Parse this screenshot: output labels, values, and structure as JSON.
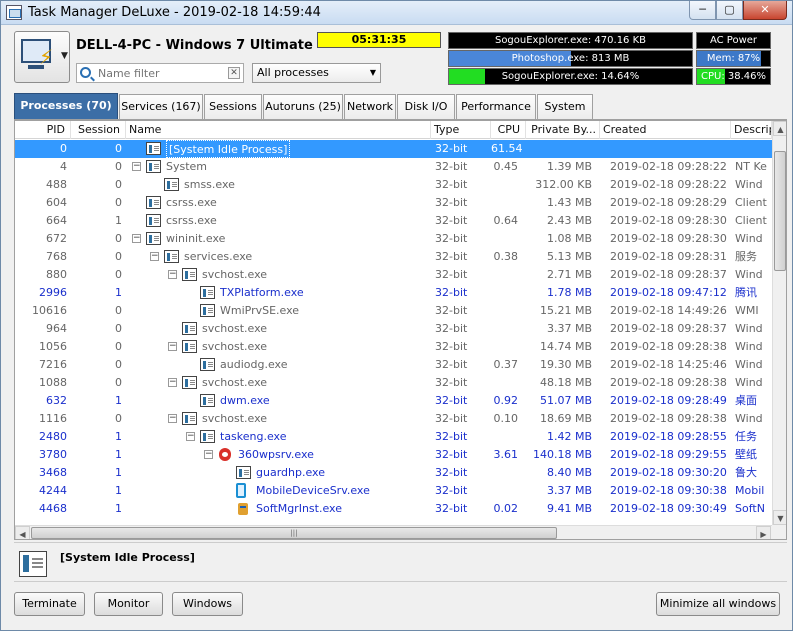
{
  "window": {
    "title": "Task Manager DeLuxe - 2019-02-18 14:59:44"
  },
  "window_controls": {
    "minimize": "─",
    "maximize": "▢",
    "close": "✕"
  },
  "header": {
    "computer": "DELL-4-PC - Windows 7 Ultimate",
    "uptime": "05:31:35",
    "filter_placeholder": "Name filter",
    "process_scope": "All processes"
  },
  "meters": [
    {
      "label": "SogouExplorer.exe: 470.16 KB",
      "fill": 0.0,
      "color": "#3c78c8"
    },
    {
      "label": "Photoshop.exe: 813 MB",
      "fill": 0.5,
      "color": "#4a86d8"
    },
    {
      "label": "SogouExplorer.exe: 14.64%",
      "fill": 0.15,
      "color": "#22dd22"
    },
    {
      "label": "AC Power",
      "fill": 0.0,
      "color": "#000000"
    },
    {
      "label": "Mem: 87%",
      "fill": 0.87,
      "color": "#3c78c8"
    },
    {
      "label": "CPU: 38.46%",
      "fill": 0.3846,
      "color": "#22dd22"
    }
  ],
  "tabs": [
    {
      "label": "Processes (70)",
      "active": true
    },
    {
      "label": "Services (167)"
    },
    {
      "label": "Sessions"
    },
    {
      "label": "Autoruns (25)"
    },
    {
      "label": "Network"
    },
    {
      "label": "Disk I/O"
    },
    {
      "label": "Performance"
    },
    {
      "label": "System"
    }
  ],
  "columns": [
    "PID",
    "Session",
    "Name",
    "Type",
    "CPU",
    "Private By...",
    "Created",
    "Descriptio"
  ],
  "rows": [
    {
      "pid": "0",
      "session": "0",
      "name": "[System Idle Process]",
      "type": "32-bit",
      "cpu": "61.54",
      "mem": "",
      "created": "",
      "desc": "",
      "level": 0,
      "expander": "",
      "icon": "app",
      "style": "sel"
    },
    {
      "pid": "4",
      "session": "0",
      "name": "System",
      "type": "32-bit",
      "cpu": "0.45",
      "mem": "1.39 MB",
      "created": "2019-02-18 09:28:22",
      "desc": "NT Ke",
      "level": 0,
      "expander": "-",
      "icon": "app",
      "style": ""
    },
    {
      "pid": "488",
      "session": "0",
      "name": "smss.exe",
      "type": "32-bit",
      "cpu": "",
      "mem": "312.00 KB",
      "created": "2019-02-18 09:28:22",
      "desc": "Wind",
      "level": 1,
      "expander": "",
      "icon": "app",
      "style": ""
    },
    {
      "pid": "604",
      "session": "0",
      "name": "csrss.exe",
      "type": "32-bit",
      "cpu": "",
      "mem": "1.43 MB",
      "created": "2019-02-18 09:28:29",
      "desc": "Client",
      "level": 0,
      "expander": "",
      "icon": "app",
      "style": ""
    },
    {
      "pid": "664",
      "session": "1",
      "name": "csrss.exe",
      "type": "32-bit",
      "cpu": "0.64",
      "mem": "2.43 MB",
      "created": "2019-02-18 09:28:30",
      "desc": "Client",
      "level": 0,
      "expander": "",
      "icon": "app",
      "style": ""
    },
    {
      "pid": "672",
      "session": "0",
      "name": "wininit.exe",
      "type": "32-bit",
      "cpu": "",
      "mem": "1.08 MB",
      "created": "2019-02-18 09:28:30",
      "desc": "Wind",
      "level": 0,
      "expander": "-",
      "icon": "app",
      "style": ""
    },
    {
      "pid": "768",
      "session": "0",
      "name": "services.exe",
      "type": "32-bit",
      "cpu": "0.38",
      "mem": "5.13 MB",
      "created": "2019-02-18 09:28:31",
      "desc": "服务",
      "level": 1,
      "expander": "-",
      "icon": "app",
      "style": ""
    },
    {
      "pid": "880",
      "session": "0",
      "name": "svchost.exe",
      "type": "32-bit",
      "cpu": "",
      "mem": "2.71 MB",
      "created": "2019-02-18 09:28:37",
      "desc": "Wind",
      "level": 2,
      "expander": "-",
      "icon": "app",
      "style": ""
    },
    {
      "pid": "2996",
      "session": "1",
      "name": "TXPlatform.exe",
      "type": "32-bit",
      "cpu": "",
      "mem": "1.78 MB",
      "created": "2019-02-18 09:47:12",
      "desc": "腾讯",
      "level": 3,
      "expander": "",
      "icon": "app",
      "style": "blue"
    },
    {
      "pid": "10616",
      "session": "0",
      "name": "WmiPrvSE.exe",
      "type": "32-bit",
      "cpu": "",
      "mem": "15.21 MB",
      "created": "2019-02-18 14:49:26",
      "desc": "WMI",
      "level": 3,
      "expander": "",
      "icon": "app",
      "style": ""
    },
    {
      "pid": "964",
      "session": "0",
      "name": "svchost.exe",
      "type": "32-bit",
      "cpu": "",
      "mem": "3.37 MB",
      "created": "2019-02-18 09:28:37",
      "desc": "Wind",
      "level": 2,
      "expander": "",
      "icon": "app",
      "style": ""
    },
    {
      "pid": "1056",
      "session": "0",
      "name": "svchost.exe",
      "type": "32-bit",
      "cpu": "",
      "mem": "14.74 MB",
      "created": "2019-02-18 09:28:38",
      "desc": "Wind",
      "level": 2,
      "expander": "-",
      "icon": "app",
      "style": ""
    },
    {
      "pid": "7216",
      "session": "0",
      "name": "audiodg.exe",
      "type": "32-bit",
      "cpu": "0.37",
      "mem": "19.30 MB",
      "created": "2019-02-18 14:25:46",
      "desc": "Wind",
      "level": 3,
      "expander": "",
      "icon": "app",
      "style": ""
    },
    {
      "pid": "1088",
      "session": "0",
      "name": "svchost.exe",
      "type": "32-bit",
      "cpu": "",
      "mem": "48.18 MB",
      "created": "2019-02-18 09:28:38",
      "desc": "Wind",
      "level": 2,
      "expander": "-",
      "icon": "app",
      "style": ""
    },
    {
      "pid": "632",
      "session": "1",
      "name": "dwm.exe",
      "type": "32-bit",
      "cpu": "0.92",
      "mem": "51.07 MB",
      "created": "2019-02-18 09:28:49",
      "desc": "桌面",
      "level": 3,
      "expander": "",
      "icon": "app",
      "style": "blue"
    },
    {
      "pid": "1116",
      "session": "0",
      "name": "svchost.exe",
      "type": "32-bit",
      "cpu": "0.10",
      "mem": "18.69 MB",
      "created": "2019-02-18 09:28:38",
      "desc": "Wind",
      "level": 2,
      "expander": "-",
      "icon": "app",
      "style": ""
    },
    {
      "pid": "2480",
      "session": "1",
      "name": "taskeng.exe",
      "type": "32-bit",
      "cpu": "",
      "mem": "1.42 MB",
      "created": "2019-02-18 09:28:55",
      "desc": "任务",
      "level": 3,
      "expander": "-",
      "icon": "app",
      "style": "blue"
    },
    {
      "pid": "3780",
      "session": "1",
      "name": "360wpsrv.exe",
      "type": "32-bit",
      "cpu": "3.61",
      "mem": "140.18 MB",
      "created": "2019-02-18 09:29:55",
      "desc": "壁纸",
      "level": 4,
      "expander": "-",
      "icon": "shield",
      "style": "blue"
    },
    {
      "pid": "3468",
      "session": "1",
      "name": "guardhp.exe",
      "type": "32-bit",
      "cpu": "",
      "mem": "8.40 MB",
      "created": "2019-02-18 09:30:20",
      "desc": "鲁大",
      "level": 5,
      "expander": "",
      "icon": "app",
      "style": "blue"
    },
    {
      "pid": "4244",
      "session": "1",
      "name": "MobileDeviceSrv.exe",
      "type": "32-bit",
      "cpu": "",
      "mem": "3.37 MB",
      "created": "2019-02-18 09:30:38",
      "desc": "Mobil",
      "level": 5,
      "expander": "",
      "icon": "phone",
      "style": "blue"
    },
    {
      "pid": "4468",
      "session": "1",
      "name": "SoftMgrInst.exe",
      "type": "32-bit",
      "cpu": "0.02",
      "mem": "9.41 MB",
      "created": "2019-02-18 09:30:49",
      "desc": "SoftN",
      "level": 5,
      "expander": "",
      "icon": "pkg",
      "style": "blue"
    }
  ],
  "detail": {
    "name": "[System Idle Process]"
  },
  "buttons": {
    "terminate": "Terminate",
    "monitor": "Monitor",
    "windows": "Windows",
    "minimize_all": "Minimize all windows"
  }
}
